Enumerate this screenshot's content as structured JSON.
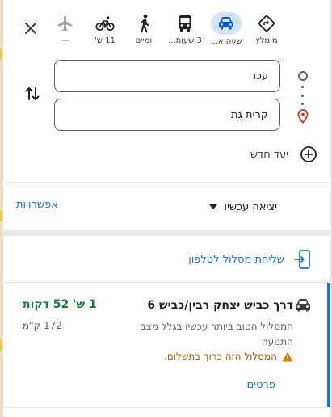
{
  "modes": [
    {
      "id": "recommended",
      "label": "מומלץ",
      "icon": "directions-diamond-icon"
    },
    {
      "id": "driving",
      "label": "שעה א...",
      "icon": "car-icon",
      "selected": true
    },
    {
      "id": "transit",
      "label": "3 שעות...",
      "icon": "bus-icon"
    },
    {
      "id": "walking",
      "label": "יומיים",
      "icon": "walking-icon"
    },
    {
      "id": "cycling",
      "label": "11 ש'",
      "icon": "bicycle-icon"
    },
    {
      "id": "flight",
      "label": "—",
      "icon": "airplane-icon",
      "disabled": true
    }
  ],
  "origin": {
    "value": "עכו"
  },
  "destination": {
    "value": "קרית גת"
  },
  "add_destination": {
    "label": "יעד חדש"
  },
  "depart": {
    "label": "יציאה עכשיו"
  },
  "options_label": "אפשרויות",
  "send_to_phone": {
    "label": "שליחת מסלול לטלפון"
  },
  "route": {
    "title": "דרך כביש יצחק רבין/כביש 6",
    "description": "המסלול הטוב ביותר עכשיו בגלל מצב התנועה",
    "warning": "המסלול הזה כרוך בתשלום.",
    "duration": "1 ש' 52 דקות",
    "distance": "172 ק\"מ",
    "details_label": "פרטים"
  },
  "colors": {
    "accent": "#1a73e8",
    "duration": "#188038",
    "warning": "#b06000",
    "selected_mode_bg": "#d3e3fd"
  }
}
